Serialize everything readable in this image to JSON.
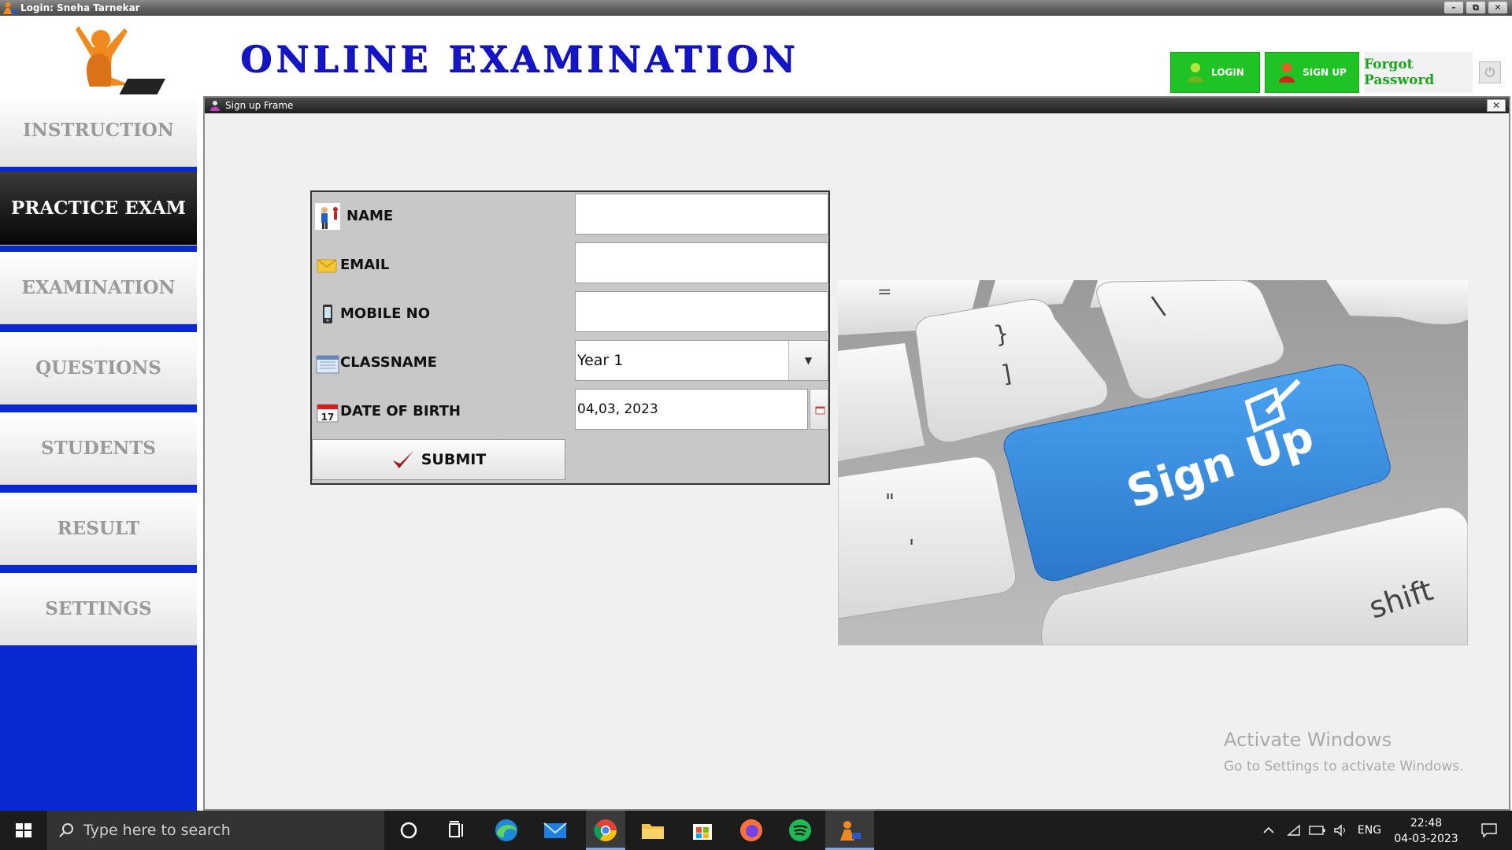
{
  "window": {
    "title": "Login: Sneha Tarnekar",
    "controls": [
      "–",
      "⧉",
      "✕"
    ]
  },
  "header": {
    "app_title": "ONLINE EXAMINATION",
    "login_label": "LOGIN",
    "signup_label": "SIGN UP",
    "forgot_label": "Forgot Password"
  },
  "sidebar": {
    "items": [
      {
        "label": "INSTRUCTION",
        "active": false
      },
      {
        "label": "PRACTICE EXAM",
        "active": true
      },
      {
        "label": "EXAMINATION",
        "active": false
      },
      {
        "label": "QUESTIONS",
        "active": false
      },
      {
        "label": "STUDENTS",
        "active": false
      },
      {
        "label": "RESULT",
        "active": false
      },
      {
        "label": "SETTINGS",
        "active": false
      }
    ]
  },
  "frame": {
    "title": "Sign up Frame",
    "close": "✕"
  },
  "form": {
    "name_label": "NAME",
    "name_value": "",
    "email_label": "EMAIL",
    "email_value": "",
    "mobile_label": "MOBILE NO",
    "mobile_value": "",
    "class_label": "CLASSNAME",
    "class_value": "Year 1",
    "dob_label": "DATE OF BIRTH",
    "dob_value": "04,03, 2023",
    "submit_label": "SUBMIT"
  },
  "image": {
    "key_text": "Sign Up",
    "shift_text": "shift",
    "bracket_key_top": "}",
    "bracket_key_bottom": "]",
    "backslash": "\\"
  },
  "watermark": {
    "title": "Activate Windows",
    "subtitle": "Go to Settings to activate Windows."
  },
  "taskbar": {
    "search_placeholder": "Type here to search",
    "language": "ENG",
    "time": "22:48",
    "date": "04-03-2023"
  },
  "colors": {
    "sidebar_blue": "#0a28d2",
    "title_blue": "#1414c8",
    "button_green": "#1fc424",
    "signup_key_blue": "#3a8fe0"
  }
}
